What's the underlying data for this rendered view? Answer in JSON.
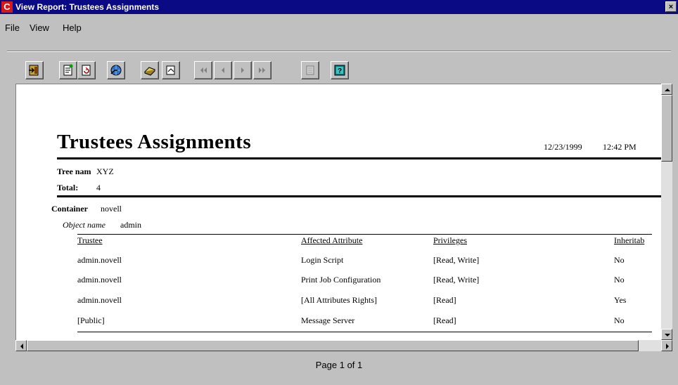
{
  "window": {
    "title": "View Report: Trustees Assignments",
    "app_icon": "C",
    "close_label": "×"
  },
  "menu": [
    {
      "label": "File"
    },
    {
      "label": "View"
    },
    {
      "label": "Help"
    }
  ],
  "toolbar": {
    "buttons": [
      {
        "name": "exit-icon"
      },
      {
        "name": "properties-icon"
      },
      {
        "name": "refresh-icon"
      },
      {
        "name": "export-icon"
      },
      {
        "name": "print-icon"
      },
      {
        "name": "zoom-icon"
      },
      {
        "name": "first-page-icon"
      },
      {
        "name": "previous-page-icon"
      },
      {
        "name": "next-page-icon"
      },
      {
        "name": "last-page-icon"
      },
      {
        "name": "book-icon"
      },
      {
        "name": "help-icon"
      }
    ]
  },
  "report": {
    "title": "Trustees Assignments",
    "date": "12/23/1999",
    "time": "12:42 PM",
    "tree_label": "Tree nam",
    "tree_value": "XYZ",
    "total_label": "Total:",
    "total_value": "4",
    "container_label": "Container",
    "container_value": "novell",
    "object_label": "Object name",
    "object_value": "admin",
    "columns": [
      "Trustee",
      "Affected Attribute",
      "Privileges",
      "Inheritab"
    ],
    "rows": [
      [
        "admin.novell",
        "Login Script",
        "[Read, Write]",
        "No"
      ],
      [
        "admin.novell",
        "Print Job Configuration",
        "[Read, Write]",
        "No"
      ],
      [
        "admin.novell",
        "[All Attributes Rights]",
        "[Read]",
        "Yes"
      ],
      [
        "[Public]",
        "Message Server",
        "[Read]",
        "No"
      ]
    ]
  },
  "status": {
    "page_text": "Page 1 of 1"
  },
  "colors": {
    "titlebar": "#0a0a84",
    "window": "#c0c0c0",
    "paper": "#ffffff",
    "app_icon": "#d81818"
  }
}
